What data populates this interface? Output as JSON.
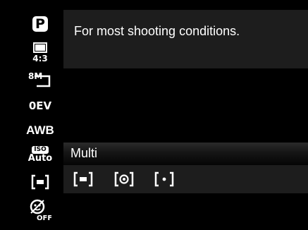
{
  "sidebar": {
    "mode_letter": "P",
    "image_ratio": "4:3",
    "image_size": "8M",
    "exposure": "0EV",
    "white_balance": "AWB",
    "iso_label": "ISO",
    "iso_value": "Auto",
    "metering_icon": "metering-multi-icon",
    "face_detect_icon": "face-detect-off-icon",
    "face_detect_state": "OFF"
  },
  "info": {
    "description": "For most shooting conditions."
  },
  "metering_menu": {
    "selected_label": "Multi",
    "options": [
      {
        "icon": "metering-multi-icon"
      },
      {
        "icon": "metering-center-icon"
      },
      {
        "icon": "metering-spot-icon"
      }
    ]
  },
  "colors": {
    "background": "#000000",
    "panel": "#1d1d1d",
    "text": "#ffffff"
  }
}
